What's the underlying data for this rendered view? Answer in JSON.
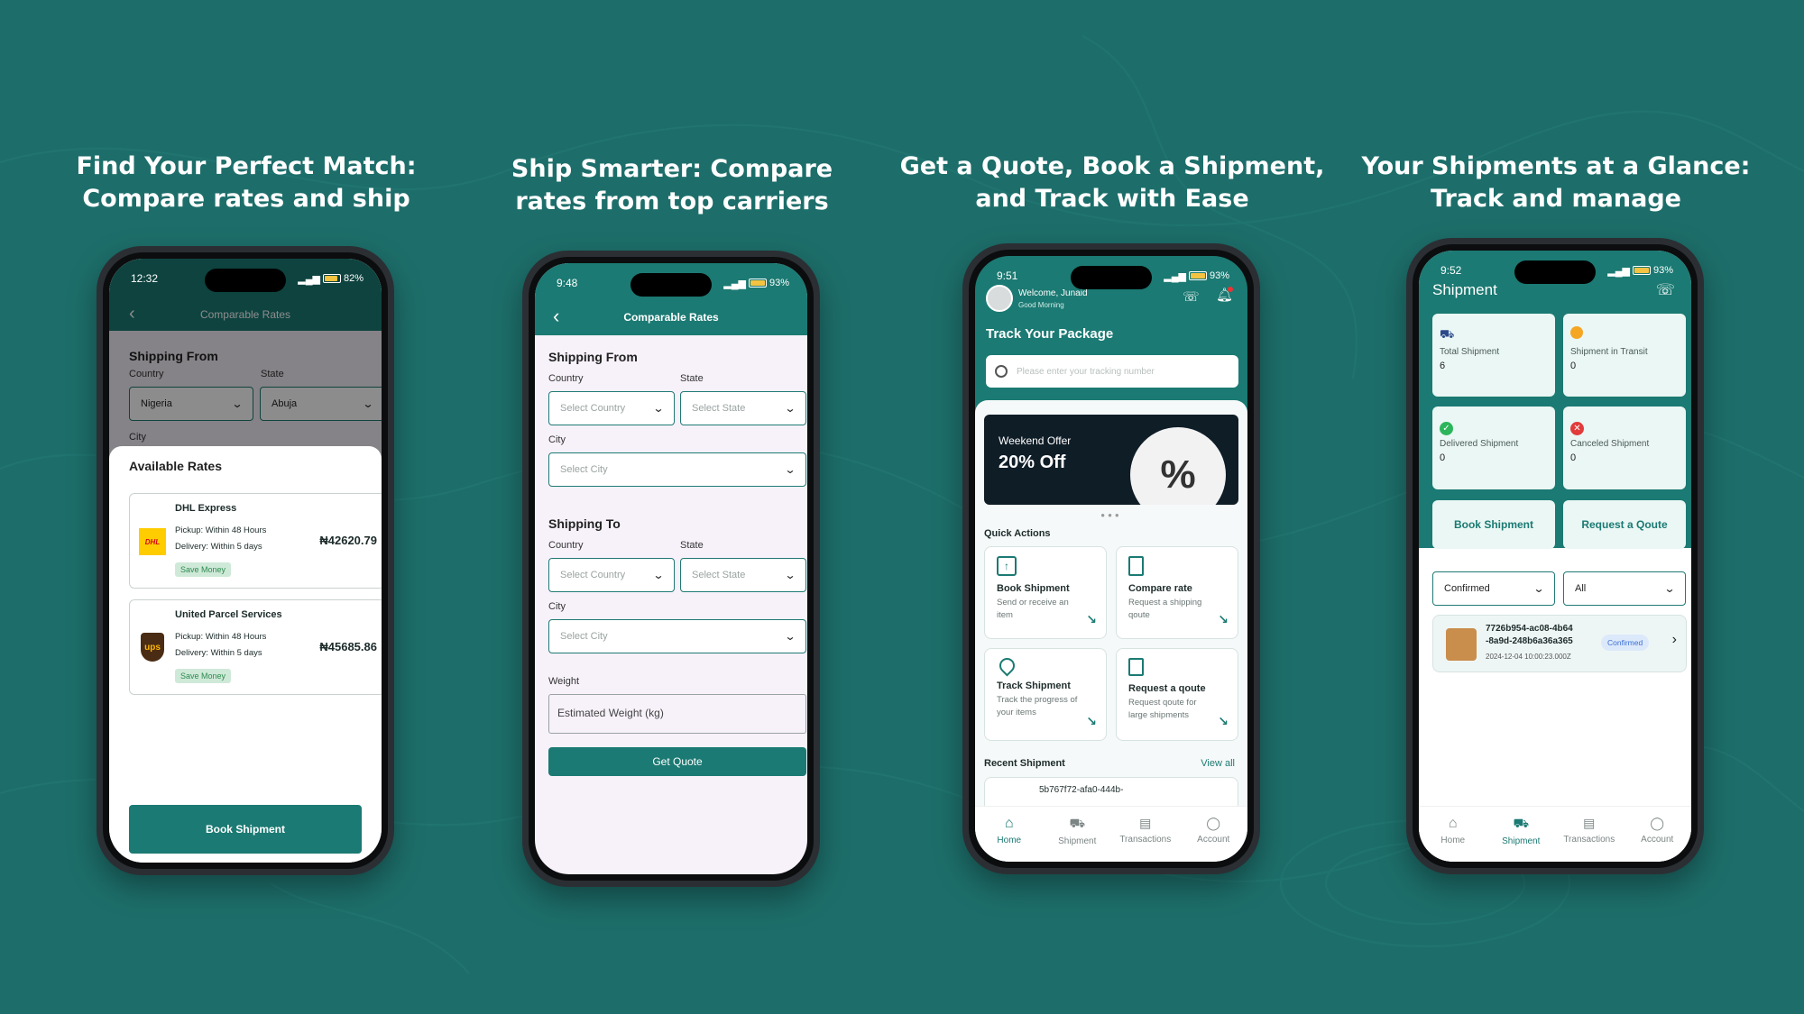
{
  "colors": {
    "background": "#1d6e6a",
    "accent": "#1b7a73",
    "accent_light": "#eaf7f4",
    "save_badge": "#cfe9d8"
  },
  "headlines": [
    {
      "line1": "Find Your Perfect Match:",
      "line2": "Compare rates and ship"
    },
    {
      "line1": "Ship Smarter: Compare",
      "line2": "rates from top carriers"
    },
    {
      "line1": "Get a Quote, Book a Shipment,",
      "line2": "and Track with Ease"
    },
    {
      "line1": "Your Shipments at a Glance:",
      "line2": "Track and manage"
    }
  ],
  "phone1": {
    "time": "12:32",
    "battery": "82%",
    "header_title": "Comparable Rates",
    "shipping_from": "Shipping From",
    "country_label": "Country",
    "state_label": "State",
    "city_label": "City",
    "country_value": "Nigeria",
    "state_value": "Abuja",
    "sheet_title": "Available Rates",
    "rates": [
      {
        "carrier": "DHL Express",
        "pickup": "Pickup: Within 48 Hours",
        "delivery": "Delivery: Within 5 days",
        "price": "₦42620.79",
        "badge": "Save Money",
        "logo": "DHL"
      },
      {
        "carrier": "United Parcel Services",
        "pickup": "Pickup: Within 48 Hours",
        "delivery": "Delivery: Within 5 days",
        "price": "₦45685.86",
        "badge": "Save Money",
        "logo": "ups"
      }
    ],
    "book_button": "Book Shipment"
  },
  "phone2": {
    "time": "9:48",
    "battery": "93%",
    "header_title": "Comparable Rates",
    "shipping_from": "Shipping From",
    "shipping_to": "Shipping To",
    "country_label": "Country",
    "state_label": "State",
    "city_label": "City",
    "select_country": "Select Country",
    "select_state": "Select State",
    "select_city": "Select City",
    "weight_label": "Weight",
    "weight_placeholder": "Estimated Weight (kg)",
    "quote_button": "Get Quote"
  },
  "phone3": {
    "time": "9:51",
    "battery": "93%",
    "welcome": "Welcome, Junaid",
    "greeting": "Good Morning",
    "track_title": "Track Your Package",
    "search_placeholder": "Please enter your tracking number",
    "offer_line1": "Weekend Offer",
    "offer_line2": "20% Off",
    "quick_actions": "Quick Actions",
    "actions": [
      {
        "title": "Book Shipment",
        "subtitle": "Send or receive an item",
        "icon": "box-upload-icon"
      },
      {
        "title": "Compare rate",
        "subtitle": "Request a shipping qoute",
        "icon": "document-icon"
      },
      {
        "title": "Track Shipment",
        "subtitle": "Track the progress of your items",
        "icon": "location-pin-icon"
      },
      {
        "title": "Request a qoute",
        "subtitle": "Request qoute for large shipments",
        "icon": "receipt-check-icon"
      }
    ],
    "recent_title": "Recent Shipment",
    "view_all": "View all",
    "recent_id": "5b767f72-afa0-444b-",
    "tabs": [
      "Home",
      "Shipment",
      "Transactions",
      "Account"
    ]
  },
  "phone4": {
    "time": "9:52",
    "battery": "93%",
    "title": "Shipment",
    "stats": [
      {
        "label": "Total Shipment",
        "value": "6"
      },
      {
        "label": "Shipment in Transit",
        "value": "0"
      },
      {
        "label": "Delivered Shipment",
        "value": "0"
      },
      {
        "label": "Canceled Shipment",
        "value": "0"
      }
    ],
    "book_button": "Book Shipment",
    "request_button": "Request a Qoute",
    "filter_status": "Confirmed",
    "filter_all": "All",
    "item_id_line1": "7726b954-ac08-4b64",
    "item_id_line2": "-8a9d-248b6a36a365",
    "item_date": "2024-12-04 10:00:23.000Z",
    "item_status": "Confirmed",
    "tabs": [
      "Home",
      "Shipment",
      "Transactions",
      "Account"
    ]
  }
}
